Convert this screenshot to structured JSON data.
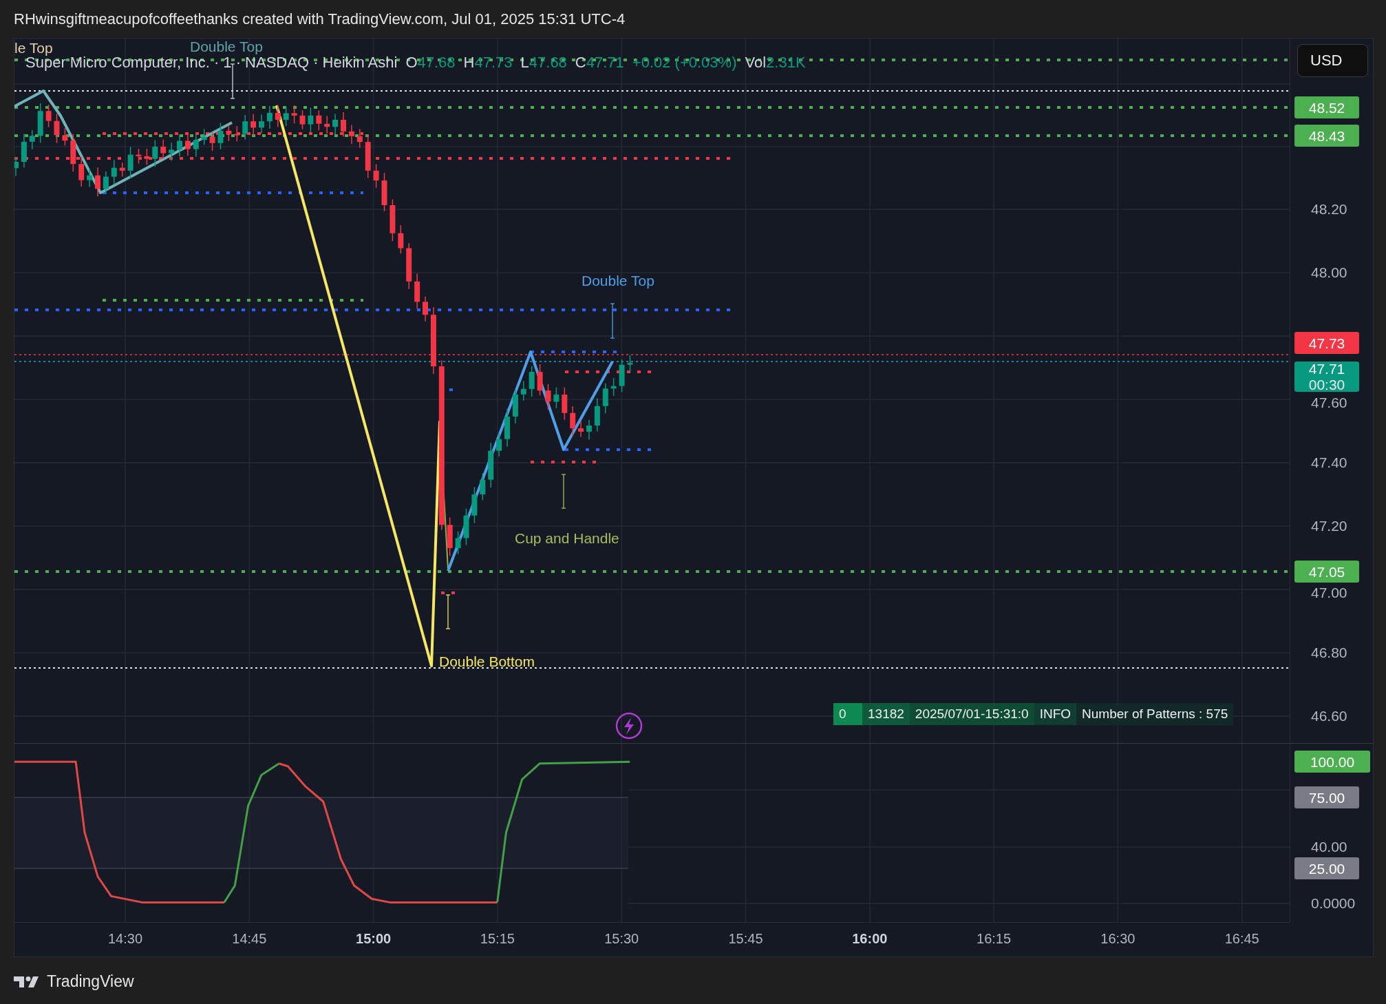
{
  "header": {
    "title": "RHwinsgiftmeacupofcoffeethanks created with TradingView.com, Jul 01, 2025 15:31 UTC-4"
  },
  "chart": {
    "legend": {
      "symbol": "Super Micro Computer, Inc. · 1 · NASDAQ · Heikin Ashi",
      "values": [
        {
          "label": "O",
          "value": "47.68"
        },
        {
          "label": "H",
          "value": "47.73"
        },
        {
          "label": "L",
          "value": "47.68"
        },
        {
          "label": "C",
          "value": "47.71"
        }
      ],
      "change": "+0.02 (+0.03%)",
      "volume": {
        "label": "Vol",
        "value": "2.31K"
      }
    },
    "currency_button": "USD",
    "pattern_labels": [
      {
        "text": "le Top",
        "color": "#e3cfa8"
      },
      {
        "text": "Double Top",
        "color": "#5fa3a8"
      },
      {
        "text": "Double Top",
        "color": "#4d9fe8"
      },
      {
        "text": "Cup and Handle",
        "color": "#a5bd5e"
      },
      {
        "text": "Double Bottom",
        "color": "#f5e663"
      }
    ],
    "price_axis": {
      "ticks": [
        "48.20",
        "48.00",
        "47.60",
        "47.40",
        "47.20",
        "47.00",
        "46.80",
        "46.60"
      ]
    },
    "price_badges": [
      {
        "text": "48.52",
        "kind": "level"
      },
      {
        "text": "48.43",
        "kind": "level"
      },
      {
        "text": "47.73",
        "kind": "high"
      },
      {
        "text": "47.71",
        "countdown": "00:30",
        "kind": "last"
      },
      {
        "text": "47.05",
        "kind": "level"
      }
    ],
    "info_table": [
      "0",
      "13182",
      "2025/07/01-15:31:0",
      "INFO",
      "Number of Patterns : 575"
    ],
    "oscillator": {
      "axis_ticks": [
        "40.00",
        "0.0000"
      ],
      "badges": [
        {
          "text": "100.00",
          "kind": "level"
        },
        {
          "text": "75.00",
          "kind": "band"
        },
        {
          "text": "25.00",
          "kind": "band"
        }
      ]
    },
    "time_axis": [
      {
        "label": "14:30",
        "major": false
      },
      {
        "label": "14:45",
        "major": false
      },
      {
        "label": "15:00",
        "major": true
      },
      {
        "label": "15:15",
        "major": false
      },
      {
        "label": "15:30",
        "major": false
      },
      {
        "label": "15:45",
        "major": false
      },
      {
        "label": "16:00",
        "major": true
      },
      {
        "label": "16:15",
        "major": false
      },
      {
        "label": "16:30",
        "major": false
      },
      {
        "label": "16:45",
        "major": false
      }
    ]
  },
  "footer": {
    "brand": "TradingView"
  }
}
